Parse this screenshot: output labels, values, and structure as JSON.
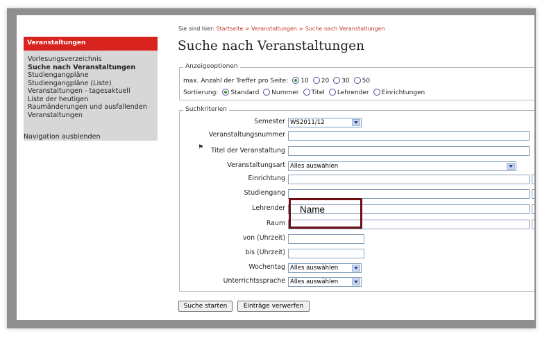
{
  "breadcrumb": {
    "prefix": "Sie sind hier:",
    "items": [
      "Startseite",
      "Veranstaltungen",
      "Suche nach Veranstaltungen"
    ],
    "separator": ">"
  },
  "page_title": "Suche nach Veranstaltungen",
  "sidebar": {
    "header": "Veranstaltungen",
    "items": [
      {
        "label": "Vorlesungsverzeichnis"
      },
      {
        "label": "Suche nach Veranstaltungen"
      },
      {
        "label": "Studiengangpläne"
      },
      {
        "label": "Studiengangpläne (Liste)"
      },
      {
        "label": "Veranstaltungen - tagesaktuell"
      },
      {
        "label": "Liste der heutigen"
      },
      {
        "label": "Raumänderungen und ausfallenden"
      },
      {
        "label": "Veranstaltungen"
      }
    ],
    "hide_nav": "Navigation ausblenden"
  },
  "display_options": {
    "legend": "Anzeigeoptionen",
    "hits_label": "max. Anzahl der Treffer pro Seite:",
    "hits_options": [
      "10",
      "20",
      "30",
      "50"
    ],
    "hits_selected": "10",
    "sort_label": "Sortierung:",
    "sort_options": [
      "Standard",
      "Nummer",
      "Titel",
      "Lehrender",
      "Einrichtungen"
    ],
    "sort_selected": "Standard"
  },
  "criteria": {
    "legend": "Suchkriterien",
    "semester_label": "Semester",
    "semester_value": "WS2011/12",
    "number_label": "Veranstaltungsnummer",
    "title_label": "Titel der Veranstaltung",
    "type_label": "Veranstaltungsart",
    "type_value": "Alles auswählen",
    "institution_label": "Einrichtung",
    "program_label": "Studiengang",
    "lecturer_label": "Lehrender",
    "room_label": "Raum",
    "from_label": "von (Uhrzeit)",
    "to_label": "bis (Uhrzeit)",
    "weekday_label": "Wochentag",
    "weekday_value": "Alles auswählen",
    "language_label": "Unterrichtssprache",
    "language_value": "Alles auswählen"
  },
  "annotation": {
    "text": "Name",
    "color": "#6b0f14"
  },
  "buttons": {
    "search": "Suche starten",
    "reset": "Einträge verwerfen"
  },
  "colors": {
    "accent_red": "#d8231e",
    "link_red": "#c0392b",
    "sidebar_bg": "#d7d7d7"
  }
}
